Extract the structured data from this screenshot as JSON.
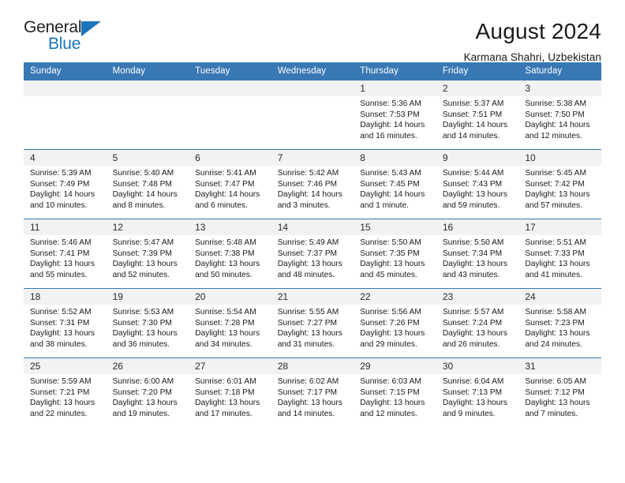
{
  "brand": {
    "name_part1": "General",
    "name_part2": "Blue",
    "triangle_icon": "triangle-icon"
  },
  "header": {
    "title": "August 2024",
    "subtitle": "Karmana Shahri, Uzbekistan"
  },
  "colors": {
    "header_blue": "#3878b4",
    "brand_blue": "#1b75bb",
    "daynum_bg": "#f2f2f2"
  },
  "weekdays": [
    "Sunday",
    "Monday",
    "Tuesday",
    "Wednesday",
    "Thursday",
    "Friday",
    "Saturday"
  ],
  "labels": {
    "sunrise": "Sunrise:",
    "sunset": "Sunset:",
    "daylight": "Daylight:"
  },
  "weeks": [
    [
      {
        "day": "",
        "empty": true
      },
      {
        "day": "",
        "empty": true
      },
      {
        "day": "",
        "empty": true
      },
      {
        "day": "",
        "empty": true
      },
      {
        "day": "1",
        "sunrise": "Sunrise: 5:36 AM",
        "sunset": "Sunset: 7:53 PM",
        "daylight": "Daylight: 14 hours and 16 minutes."
      },
      {
        "day": "2",
        "sunrise": "Sunrise: 5:37 AM",
        "sunset": "Sunset: 7:51 PM",
        "daylight": "Daylight: 14 hours and 14 minutes."
      },
      {
        "day": "3",
        "sunrise": "Sunrise: 5:38 AM",
        "sunset": "Sunset: 7:50 PM",
        "daylight": "Daylight: 14 hours and 12 minutes."
      }
    ],
    [
      {
        "day": "4",
        "sunrise": "Sunrise: 5:39 AM",
        "sunset": "Sunset: 7:49 PM",
        "daylight": "Daylight: 14 hours and 10 minutes."
      },
      {
        "day": "5",
        "sunrise": "Sunrise: 5:40 AM",
        "sunset": "Sunset: 7:48 PM",
        "daylight": "Daylight: 14 hours and 8 minutes."
      },
      {
        "day": "6",
        "sunrise": "Sunrise: 5:41 AM",
        "sunset": "Sunset: 7:47 PM",
        "daylight": "Daylight: 14 hours and 6 minutes."
      },
      {
        "day": "7",
        "sunrise": "Sunrise: 5:42 AM",
        "sunset": "Sunset: 7:46 PM",
        "daylight": "Daylight: 14 hours and 3 minutes."
      },
      {
        "day": "8",
        "sunrise": "Sunrise: 5:43 AM",
        "sunset": "Sunset: 7:45 PM",
        "daylight": "Daylight: 14 hours and 1 minute."
      },
      {
        "day": "9",
        "sunrise": "Sunrise: 5:44 AM",
        "sunset": "Sunset: 7:43 PM",
        "daylight": "Daylight: 13 hours and 59 minutes."
      },
      {
        "day": "10",
        "sunrise": "Sunrise: 5:45 AM",
        "sunset": "Sunset: 7:42 PM",
        "daylight": "Daylight: 13 hours and 57 minutes."
      }
    ],
    [
      {
        "day": "11",
        "sunrise": "Sunrise: 5:46 AM",
        "sunset": "Sunset: 7:41 PM",
        "daylight": "Daylight: 13 hours and 55 minutes."
      },
      {
        "day": "12",
        "sunrise": "Sunrise: 5:47 AM",
        "sunset": "Sunset: 7:39 PM",
        "daylight": "Daylight: 13 hours and 52 minutes."
      },
      {
        "day": "13",
        "sunrise": "Sunrise: 5:48 AM",
        "sunset": "Sunset: 7:38 PM",
        "daylight": "Daylight: 13 hours and 50 minutes."
      },
      {
        "day": "14",
        "sunrise": "Sunrise: 5:49 AM",
        "sunset": "Sunset: 7:37 PM",
        "daylight": "Daylight: 13 hours and 48 minutes."
      },
      {
        "day": "15",
        "sunrise": "Sunrise: 5:50 AM",
        "sunset": "Sunset: 7:35 PM",
        "daylight": "Daylight: 13 hours and 45 minutes."
      },
      {
        "day": "16",
        "sunrise": "Sunrise: 5:50 AM",
        "sunset": "Sunset: 7:34 PM",
        "daylight": "Daylight: 13 hours and 43 minutes."
      },
      {
        "day": "17",
        "sunrise": "Sunrise: 5:51 AM",
        "sunset": "Sunset: 7:33 PM",
        "daylight": "Daylight: 13 hours and 41 minutes."
      }
    ],
    [
      {
        "day": "18",
        "sunrise": "Sunrise: 5:52 AM",
        "sunset": "Sunset: 7:31 PM",
        "daylight": "Daylight: 13 hours and 38 minutes."
      },
      {
        "day": "19",
        "sunrise": "Sunrise: 5:53 AM",
        "sunset": "Sunset: 7:30 PM",
        "daylight": "Daylight: 13 hours and 36 minutes."
      },
      {
        "day": "20",
        "sunrise": "Sunrise: 5:54 AM",
        "sunset": "Sunset: 7:28 PM",
        "daylight": "Daylight: 13 hours and 34 minutes."
      },
      {
        "day": "21",
        "sunrise": "Sunrise: 5:55 AM",
        "sunset": "Sunset: 7:27 PM",
        "daylight": "Daylight: 13 hours and 31 minutes."
      },
      {
        "day": "22",
        "sunrise": "Sunrise: 5:56 AM",
        "sunset": "Sunset: 7:26 PM",
        "daylight": "Daylight: 13 hours and 29 minutes."
      },
      {
        "day": "23",
        "sunrise": "Sunrise: 5:57 AM",
        "sunset": "Sunset: 7:24 PM",
        "daylight": "Daylight: 13 hours and 26 minutes."
      },
      {
        "day": "24",
        "sunrise": "Sunrise: 5:58 AM",
        "sunset": "Sunset: 7:23 PM",
        "daylight": "Daylight: 13 hours and 24 minutes."
      }
    ],
    [
      {
        "day": "25",
        "sunrise": "Sunrise: 5:59 AM",
        "sunset": "Sunset: 7:21 PM",
        "daylight": "Daylight: 13 hours and 22 minutes."
      },
      {
        "day": "26",
        "sunrise": "Sunrise: 6:00 AM",
        "sunset": "Sunset: 7:20 PM",
        "daylight": "Daylight: 13 hours and 19 minutes."
      },
      {
        "day": "27",
        "sunrise": "Sunrise: 6:01 AM",
        "sunset": "Sunset: 7:18 PM",
        "daylight": "Daylight: 13 hours and 17 minutes."
      },
      {
        "day": "28",
        "sunrise": "Sunrise: 6:02 AM",
        "sunset": "Sunset: 7:17 PM",
        "daylight": "Daylight: 13 hours and 14 minutes."
      },
      {
        "day": "29",
        "sunrise": "Sunrise: 6:03 AM",
        "sunset": "Sunset: 7:15 PM",
        "daylight": "Daylight: 13 hours and 12 minutes."
      },
      {
        "day": "30",
        "sunrise": "Sunrise: 6:04 AM",
        "sunset": "Sunset: 7:13 PM",
        "daylight": "Daylight: 13 hours and 9 minutes."
      },
      {
        "day": "31",
        "sunrise": "Sunrise: 6:05 AM",
        "sunset": "Sunset: 7:12 PM",
        "daylight": "Daylight: 13 hours and 7 minutes."
      }
    ]
  ]
}
